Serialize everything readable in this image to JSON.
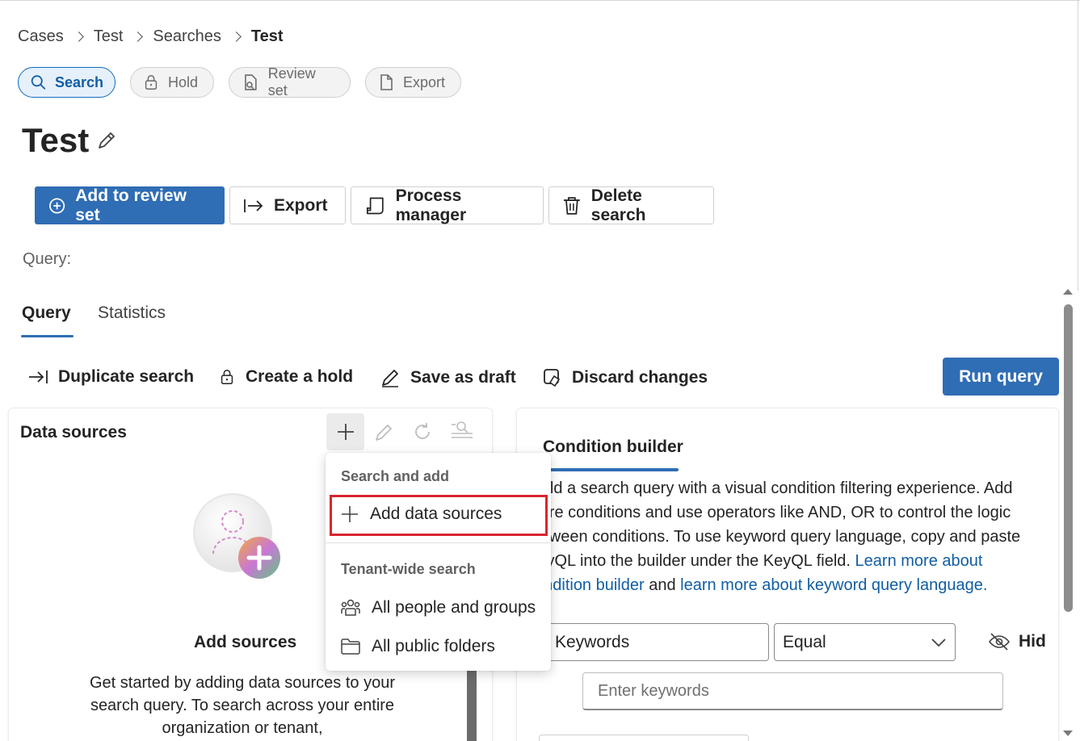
{
  "breadcrumb": [
    "Cases",
    "Test",
    "Searches",
    "Test"
  ],
  "pills": {
    "search": "Search",
    "hold": "Hold",
    "review_set": "Review set",
    "export": "Export"
  },
  "page_title": "Test",
  "actions": {
    "add_to_review_set": "Add to review set",
    "export": "Export",
    "process_manager": "Process manager",
    "delete_search": "Delete search"
  },
  "query_label": "Query:",
  "tabs": {
    "query": "Query",
    "statistics": "Statistics"
  },
  "commands": {
    "duplicate_search": "Duplicate search",
    "create_hold": "Create a hold",
    "save_as_draft": "Save as draft",
    "discard_changes": "Discard changes",
    "run_query": "Run query"
  },
  "data_sources": {
    "title": "Data sources",
    "add_sources_title": "Add sources",
    "add_sources_desc": "Get started by adding data sources to your search query. To search across your entire organization or tenant,"
  },
  "menu": {
    "header_search_add": "Search and add",
    "add_data_sources": "Add data sources",
    "header_tenant": "Tenant-wide search",
    "all_people_groups": "All people and groups",
    "all_public_folders": "All public folders"
  },
  "condition_builder": {
    "title": "Condition builder",
    "desc_text": "Build a search query with a visual condition filtering experience. Add more conditions and use operators like AND, OR to control the logic between conditions. To use keyword query language, copy and paste KeyQL into the builder under the KeyQL field. ",
    "link1": "Learn more about condition builder",
    "and": " and ",
    "link2": "learn more about keyword query language.",
    "keywords_field": "Keywords",
    "operator_field": "Equal",
    "hide_label": "Hide",
    "enter_keywords_placeholder": "Enter keywords"
  },
  "colors": {
    "accent": "#2f6db4",
    "link": "#115ea3",
    "highlight": "#d9252e"
  }
}
